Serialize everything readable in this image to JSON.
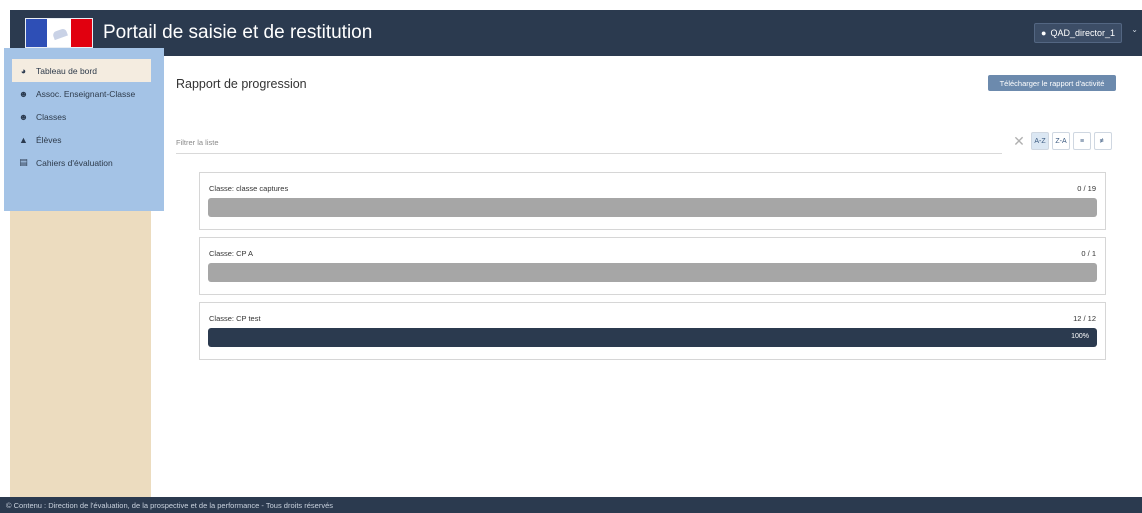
{
  "header": {
    "title": "Portail de saisie et de restitution",
    "user": "QAD_director_1"
  },
  "sidebar": {
    "items": [
      {
        "label": "Tableau de bord",
        "icon": "dashboard-icon"
      },
      {
        "label": "Assoc. Enseignant-Classe",
        "icon": "users-icon"
      },
      {
        "label": "Classes",
        "icon": "users-icon"
      },
      {
        "label": "Élèves",
        "icon": "graduation-cap-icon"
      },
      {
        "label": "Cahiers d'évaluation",
        "icon": "notebook-icon"
      }
    ]
  },
  "main": {
    "title": "Rapport de progression",
    "download_button": "Télécharger le rapport d'activité",
    "filter_placeholder": "Filtrer la liste",
    "sort": {
      "az": "A-Z",
      "za": "Z-A"
    },
    "cards": [
      {
        "label": "Classe: classe captures",
        "count": "0 / 19",
        "progress": 0,
        "percent_label": ""
      },
      {
        "label": "Classe: CP A",
        "count": "0 / 1",
        "progress": 0,
        "percent_label": ""
      },
      {
        "label": "Classe: CP test",
        "count": "12 / 12",
        "progress": 1,
        "percent_label": "100%"
      }
    ]
  },
  "footer": {
    "text": "© Contenu : Direction de l'évaluation, de la prospective et de la performance - Tous droits réservés"
  },
  "colors": {
    "header_bg": "#2b3a4f",
    "sidebar_bg": "#ecdcbf",
    "progress_fill": "#2b3a4f",
    "progress_track": "#a6a6a6",
    "button_bg": "#6c8aad"
  }
}
